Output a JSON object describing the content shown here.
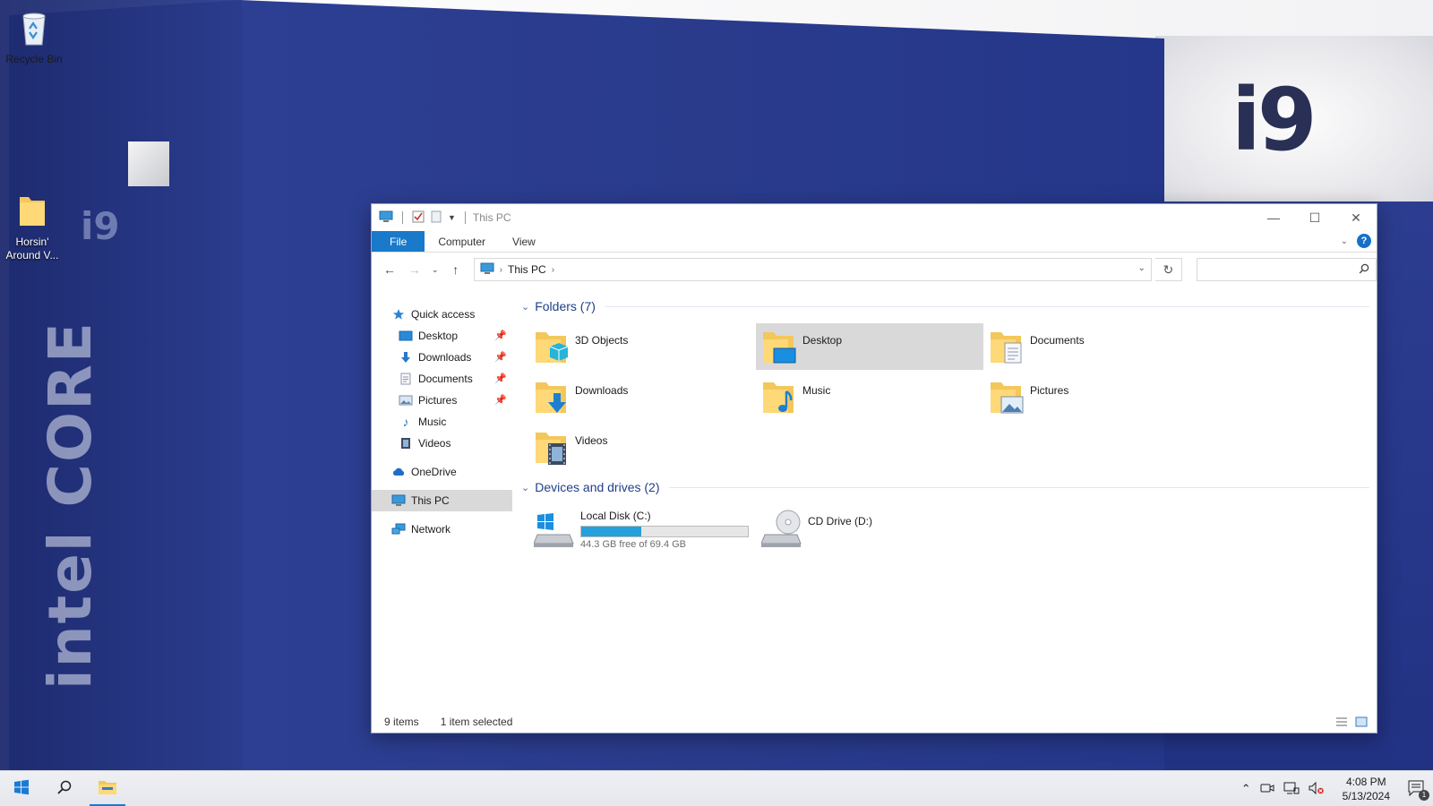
{
  "desktop": {
    "icons": [
      {
        "label": "Recycle Bin"
      },
      {
        "label": "Horsin'\nAround V..."
      }
    ],
    "wallpaper_text": {
      "big": "i9",
      "small": "i9",
      "vertical": "intel CORE"
    }
  },
  "window": {
    "title": "This PC",
    "ribbon_tabs": [
      "File",
      "Computer",
      "View"
    ],
    "help_label": "?",
    "address": {
      "crumbs": [
        "This PC"
      ]
    },
    "search": {
      "placeholder": "",
      "value": ""
    },
    "nav": {
      "quick_access": "Quick access",
      "pinned": [
        "Desktop",
        "Downloads",
        "Documents",
        "Pictures"
      ],
      "unpinned": [
        "Music",
        "Videos"
      ],
      "onedrive": "OneDrive",
      "this_pc": "This PC",
      "network": "Network"
    },
    "folders_header": "Folders (7)",
    "folders": [
      {
        "name": "3D Objects",
        "icon": "3d-objects-folder-icon"
      },
      {
        "name": "Desktop",
        "icon": "desktop-folder-icon",
        "selected": true
      },
      {
        "name": "Documents",
        "icon": "documents-folder-icon"
      },
      {
        "name": "Downloads",
        "icon": "downloads-folder-icon"
      },
      {
        "name": "Music",
        "icon": "music-folder-icon"
      },
      {
        "name": "Pictures",
        "icon": "pictures-folder-icon"
      },
      {
        "name": "Videos",
        "icon": "videos-folder-icon"
      }
    ],
    "devices_header": "Devices and drives (2)",
    "drives": [
      {
        "name": "Local Disk (C:)",
        "free_text": "44.3 GB free of 69.4 GB",
        "used_fraction": 0.36
      },
      {
        "name": "CD Drive (D:)"
      }
    ],
    "status": {
      "items": "9 items",
      "selected": "1 item selected"
    }
  },
  "taskbar": {
    "time": "4:08 PM",
    "date": "5/13/2024",
    "notification_count": "1"
  },
  "colors": {
    "accent": "#1979ca",
    "progress": "#26a0da",
    "selection": "#d9d9d9"
  }
}
